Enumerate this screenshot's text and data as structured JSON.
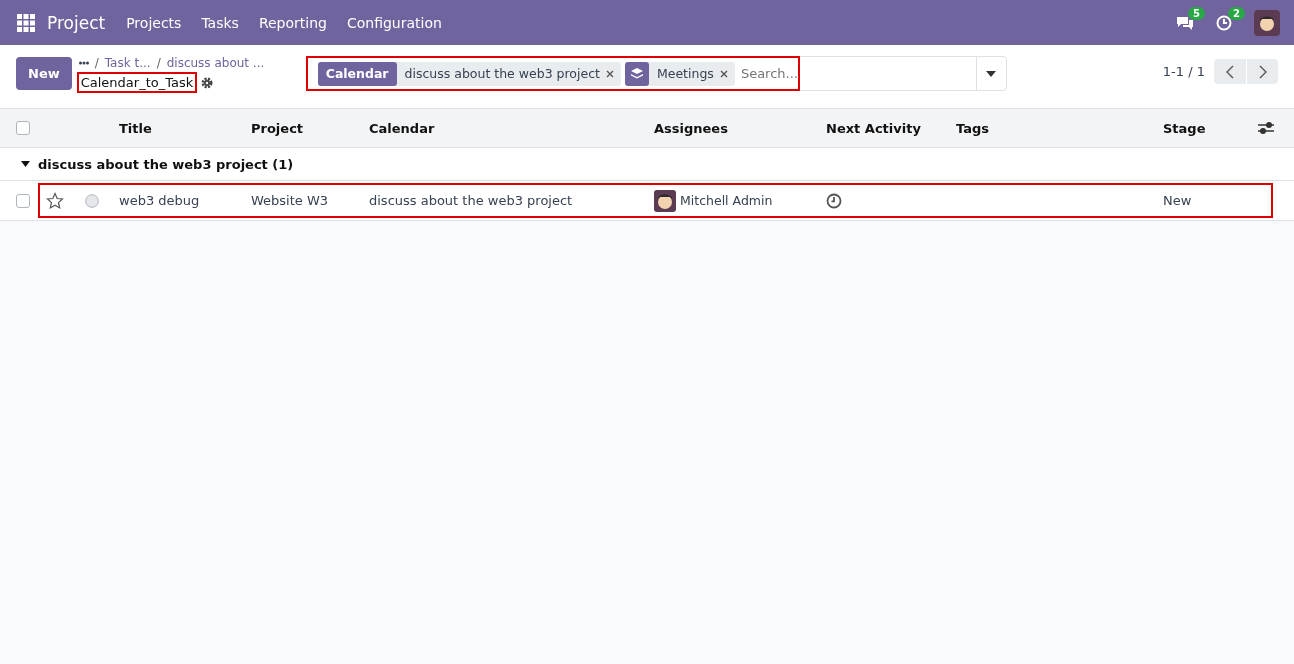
{
  "navbar": {
    "app_name": "Project",
    "menu": [
      "Projects",
      "Tasks",
      "Reporting",
      "Configuration"
    ],
    "messages_count": "5",
    "activities_count": "2"
  },
  "control_panel": {
    "new_button": "New",
    "breadcrumbs": [
      {
        "separator": "/",
        "label": "Task t..."
      },
      {
        "separator": "/",
        "label": "discuss about ..."
      }
    ],
    "title": {
      "text": "Calendar_to_Task",
      "highlighted": true
    },
    "search": {
      "highlighted": true,
      "placeholder": "Search...",
      "facets": [
        {
          "kind": "field",
          "label": "Calendar",
          "value": "discuss about the web3 project"
        },
        {
          "kind": "filter",
          "value": "Meetings"
        }
      ]
    },
    "pager": "1-1 / 1"
  },
  "list": {
    "select_all_checked": false,
    "columns": [
      "Title",
      "Project",
      "Calendar",
      "Assignees",
      "Next Activity",
      "Tags",
      "Stage"
    ],
    "groups": [
      {
        "label": "discuss about the web3 project (1)",
        "expanded": true,
        "rows": [
          {
            "highlighted": true,
            "checked": false,
            "starred": false,
            "title": "web3 debug",
            "project": "Website W3",
            "calendar": "discuss about the web3 project",
            "assignee": "Mitchell Admin",
            "stage": "New"
          }
        ]
      }
    ]
  }
}
